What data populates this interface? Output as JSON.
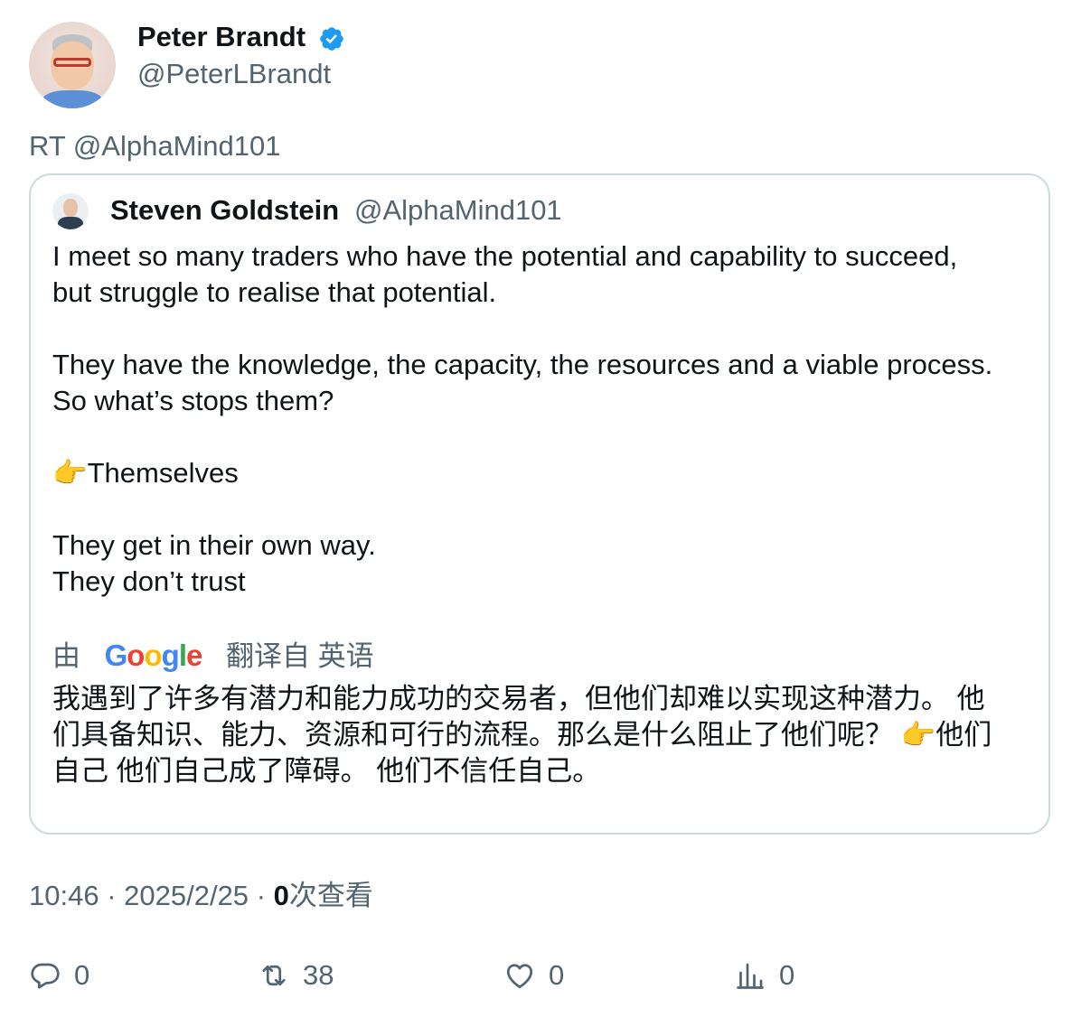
{
  "author": {
    "display_name": "Peter Brandt",
    "handle": "@PeterLBrandt",
    "verified": true
  },
  "retweet_line": "RT @AlphaMind101",
  "quoted": {
    "display_name": "Steven Goldstein",
    "handle": "@AlphaMind101",
    "lines": [
      "I meet so many traders who have the potential and capability to succeed,",
      "but struggle to realise that potential.",
      "They have the knowledge, the capacity, the resources and a viable process.",
      "So what’s stops them?",
      "👉Themselves",
      "They get in their own way.",
      "They don’t trust"
    ],
    "translation": {
      "prefix": "由",
      "google": [
        "G",
        "o",
        "o",
        "g",
        "l",
        "e"
      ],
      "suffix": "翻译自 英语",
      "lines": [
        "我遇到了许多有潜力和能力成功的交易者，但他们却难以实现这种潜力。 他",
        "们具备知识、能力、资源和可行的流程。那么是什么阻止了他们呢？ 👉他们",
        "自己 他们自己成了障碍。 他们不信任自己。"
      ]
    }
  },
  "meta": {
    "time": "10:46",
    "date": "2025/2/25",
    "views_count": "0",
    "views_label": "次查看"
  },
  "actions": {
    "replies": "0",
    "retweets": "38",
    "likes": "0",
    "views": "0"
  },
  "colors": {
    "verified": "#1d9bf0",
    "secondary_text": "#536471",
    "border": "#cfd9de"
  }
}
